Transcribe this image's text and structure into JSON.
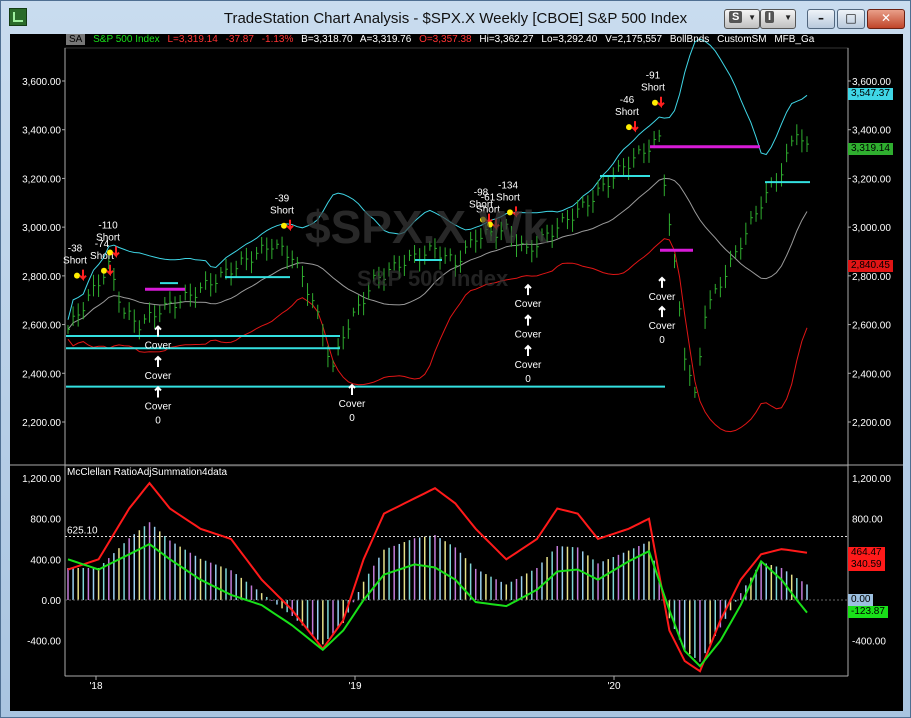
{
  "window": {
    "title": "TradeStation Chart Analysis - $SPX.X Weekly [CBOE] S&P 500 Index",
    "style_button_label": "S",
    "format_button_label": "I"
  },
  "status": {
    "symbol_badge": "SA",
    "name": "S&P 500 Index",
    "last": "L=3,319.14",
    "change": "-37.87",
    "pct_change": "-1.13%",
    "bid": "B=3,318.70",
    "ask": "A=3,319.76",
    "open": "O=3,357.38",
    "high": "Hi=3,362.27",
    "low": "Lo=3,292.40",
    "volume": "V=2,175,557",
    "study1": "BollBnds",
    "study2": "CustomSM",
    "study3": "MFB_Ga"
  },
  "watermark": {
    "symbol": "$SPX.X Wk",
    "name": "S&P 500 Index"
  },
  "indicator": {
    "title": "McClellan RatioAdjSummation4data"
  },
  "price_axis": {
    "labels": [
      "3,600.00",
      "3,400.00",
      "3,200.00",
      "3,000.00",
      "2,800.00",
      "2,600.00",
      "2,400.00",
      "2,200.00"
    ]
  },
  "osc_axis": {
    "labels": [
      "1,200.00",
      "800.00",
      "400.00",
      "0.00",
      "-400.00"
    ],
    "level_label": "625.10"
  },
  "x_axis": {
    "labels": [
      "'18",
      "'19",
      "'20"
    ]
  },
  "price_tags": {
    "upper_band": "3,547.37",
    "last": "3,319.14",
    "lower_band": "2,840.45"
  },
  "osc_tags": {
    "red": "464.47",
    "green_top": "340.59",
    "zero": "0.00",
    "green": "-123.87"
  },
  "signals": {
    "short": [
      {
        "num": "-38",
        "label": "Short"
      },
      {
        "num": "-74",
        "label": "Short"
      },
      {
        "num": "-110",
        "label": "Short"
      },
      {
        "num": "-39",
        "label": "Short"
      },
      {
        "num": "-98",
        "label": "Short"
      },
      {
        "num": "-61",
        "label": "Short"
      },
      {
        "num": "-134",
        "label": "Short"
      },
      {
        "num": "-46",
        "label": "Short"
      },
      {
        "num": "-91",
        "label": "Short"
      }
    ],
    "cover": [
      {
        "label": "Cover"
      },
      {
        "label": "Cover"
      },
      {
        "label": "Cover",
        "num": "0"
      },
      {
        "label": "Cover",
        "num": "0"
      },
      {
        "label": "Cover"
      },
      {
        "label": "Cover"
      },
      {
        "label": "Cover",
        "num": "0"
      },
      {
        "label": "Cover"
      },
      {
        "label": "Cover",
        "num": "0"
      }
    ]
  },
  "colors": {
    "upper_band": "#3fd6e6",
    "lower_band": "#e01515",
    "mid_band": "#9a9a9a",
    "price_bars": "#2fae2f",
    "osc_red": "#ff1a1a",
    "osc_green": "#19e019",
    "magenta": "#d81bd8",
    "cyan_lines": "#33e0e0"
  }
}
